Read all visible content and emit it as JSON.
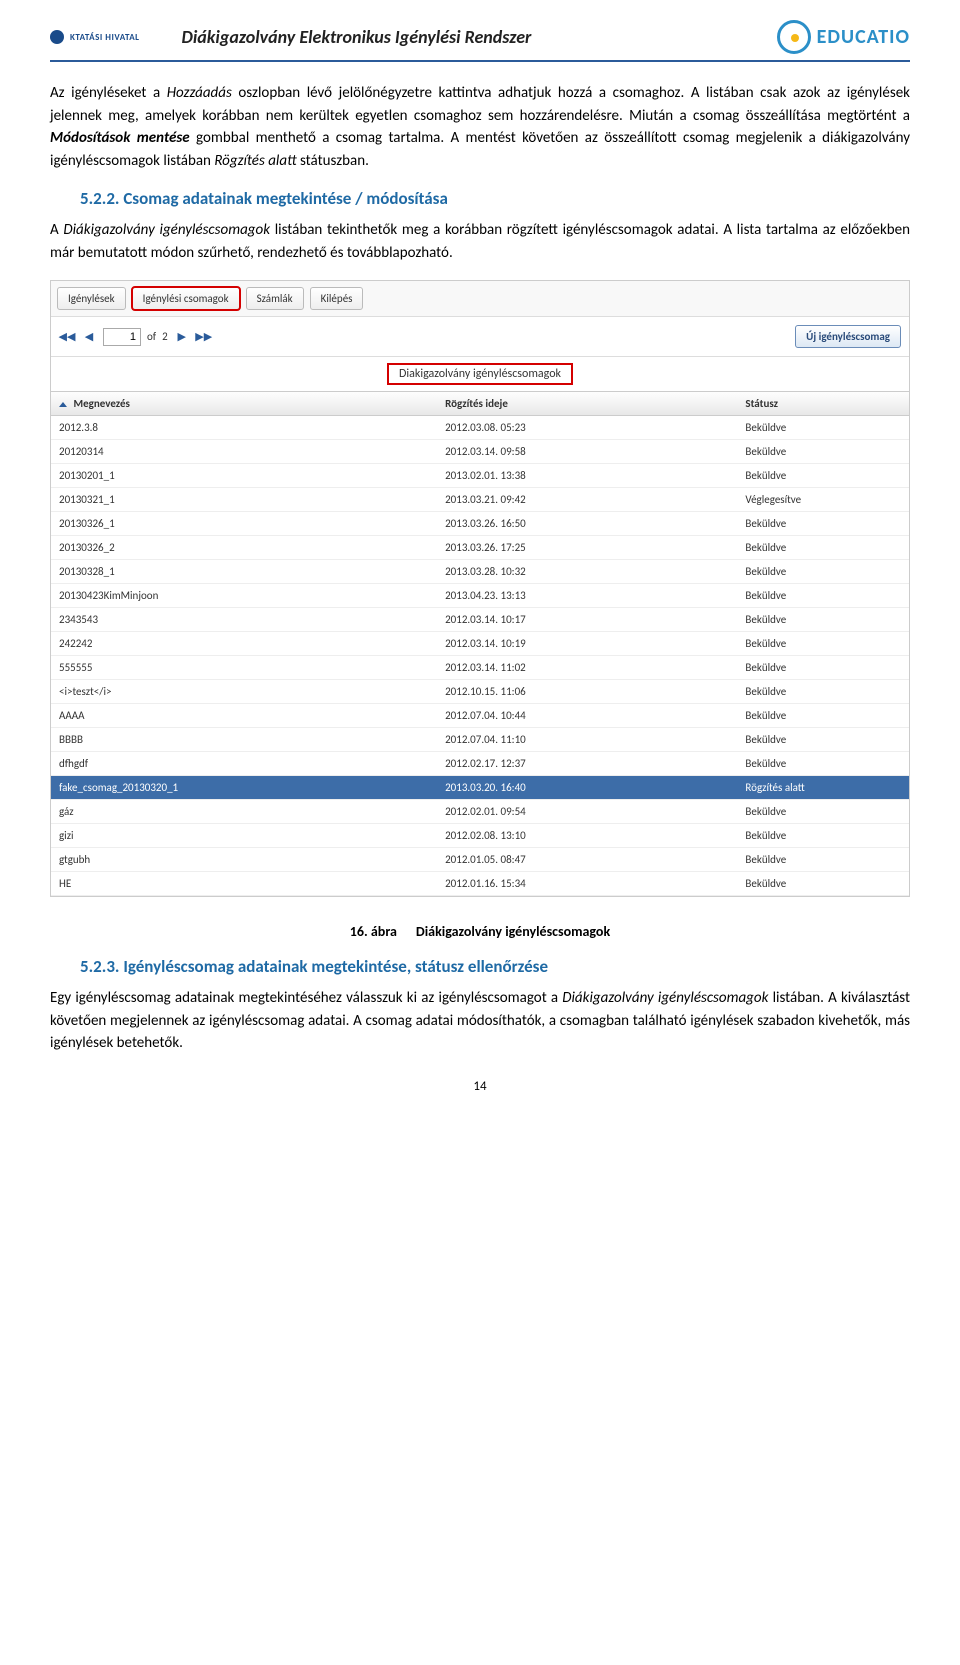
{
  "header": {
    "hivatal_label": "KTATÁSI HIVATAL",
    "title": "Diákigazolvány Elektronikus Igénylési Rendszer",
    "educatio_label": "EDUCATIO"
  },
  "para1": {
    "t1": "Az igényléseket a ",
    "i1": "Hozzáadás",
    "t2": " oszlopban lévő jelölőnégyzetre kattintva adhatjuk hozzá a csomaghoz. A listában csak azok az igénylések jelennek meg, amelyek korábban nem kerültek egyetlen csomaghoz sem hozzárendelésre. Miután a csomag összeállítása megtörtént a ",
    "bi1": "Módosítások mentése",
    "t3": " gombbal menthető a csomag tartalma. A mentést követően az összeállított csomag megjelenik a diákigazolvány igényléscsomagok listában ",
    "i2": "Rögzítés alatt",
    "t4": " státuszban."
  },
  "section522": "5.2.2. Csomag adatainak megtekintése / módosítása",
  "para2": {
    "t1": "A ",
    "i1": "Diákigazolvány igényléscsomagok",
    "t2": " listában tekinthetők meg a korábban rögzített igényléscsomagok adatai. A lista tartalma az előzőekben már bemutatott módon szűrhető, rendezhető és továbblapozható."
  },
  "screenshot": {
    "tabs": [
      "Igénylések",
      "Igénylési csomagok",
      "Számlák",
      "Kilépés"
    ],
    "pager": {
      "value": "1",
      "of": "of",
      "total": "2"
    },
    "new_button": "Új igényléscsomag",
    "table_title": "Diakigazolvány igényléscsomagok",
    "columns": {
      "c1": "Megnevezés",
      "c2": "Rögzítés ideje",
      "c3": "Státusz"
    },
    "rows": [
      {
        "c1": "2012.3.8",
        "c2": "2012.03.08. 05:23",
        "c3": "Beküldve",
        "sel": false
      },
      {
        "c1": "20120314",
        "c2": "2012.03.14. 09:58",
        "c3": "Beküldve",
        "sel": false
      },
      {
        "c1": "20130201_1",
        "c2": "2013.02.01. 13:38",
        "c3": "Beküldve",
        "sel": false
      },
      {
        "c1": "20130321_1",
        "c2": "2013.03.21. 09:42",
        "c3": "Véglegesítve",
        "sel": false
      },
      {
        "c1": "20130326_1",
        "c2": "2013.03.26. 16:50",
        "c3": "Beküldve",
        "sel": false
      },
      {
        "c1": "20130326_2",
        "c2": "2013.03.26. 17:25",
        "c3": "Beküldve",
        "sel": false
      },
      {
        "c1": "20130328_1",
        "c2": "2013.03.28. 10:32",
        "c3": "Beküldve",
        "sel": false
      },
      {
        "c1": "20130423KimMinjoon",
        "c2": "2013.04.23. 13:13",
        "c3": "Beküldve",
        "sel": false
      },
      {
        "c1": "2343543",
        "c2": "2012.03.14. 10:17",
        "c3": "Beküldve",
        "sel": false
      },
      {
        "c1": "242242",
        "c2": "2012.03.14. 10:19",
        "c3": "Beküldve",
        "sel": false
      },
      {
        "c1": "555555",
        "c2": "2012.03.14. 11:02",
        "c3": "Beküldve",
        "sel": false
      },
      {
        "c1": "<i>teszt</i>",
        "c2": "2012.10.15. 11:06",
        "c3": "Beküldve",
        "sel": false
      },
      {
        "c1": "AAAA",
        "c2": "2012.07.04. 10:44",
        "c3": "Beküldve",
        "sel": false
      },
      {
        "c1": "BBBB",
        "c2": "2012.07.04. 11:10",
        "c3": "Beküldve",
        "sel": false
      },
      {
        "c1": "dfhgdf",
        "c2": "2012.02.17. 12:37",
        "c3": "Beküldve",
        "sel": false
      },
      {
        "c1": "fake_csomag_20130320_1",
        "c2": "2013.03.20. 16:40",
        "c3": "Rögzítés alatt",
        "sel": true
      },
      {
        "c1": "gáz",
        "c2": "2012.02.01. 09:54",
        "c3": "Beküldve",
        "sel": false
      },
      {
        "c1": "gizi",
        "c2": "2012.02.08. 13:10",
        "c3": "Beküldve",
        "sel": false
      },
      {
        "c1": "gtgubh",
        "c2": "2012.01.05. 08:47",
        "c3": "Beküldve",
        "sel": false
      },
      {
        "c1": "HE",
        "c2": "2012.01.16. 15:34",
        "c3": "Beküldve",
        "sel": false
      }
    ]
  },
  "caption": {
    "num": "16. ábra",
    "text": "Diákigazolvány igényléscsomagok"
  },
  "section523": "5.2.3. Igényléscsomag adatainak megtekintése, státusz ellenőrzése",
  "para3": {
    "t1": "Egy igényléscsomag adatainak megtekintéséhez válasszuk ki az igényléscsomagot a ",
    "i1": "Diákigazolvány igényléscsomagok",
    "t2": " listában. A kiválasztást követően megjelennek az igényléscsomag adatai. A csomag adatai módosíthatók, a csomagban található igénylések szabadon kivehetők, más igénylések betehetők."
  },
  "page_number": "14"
}
